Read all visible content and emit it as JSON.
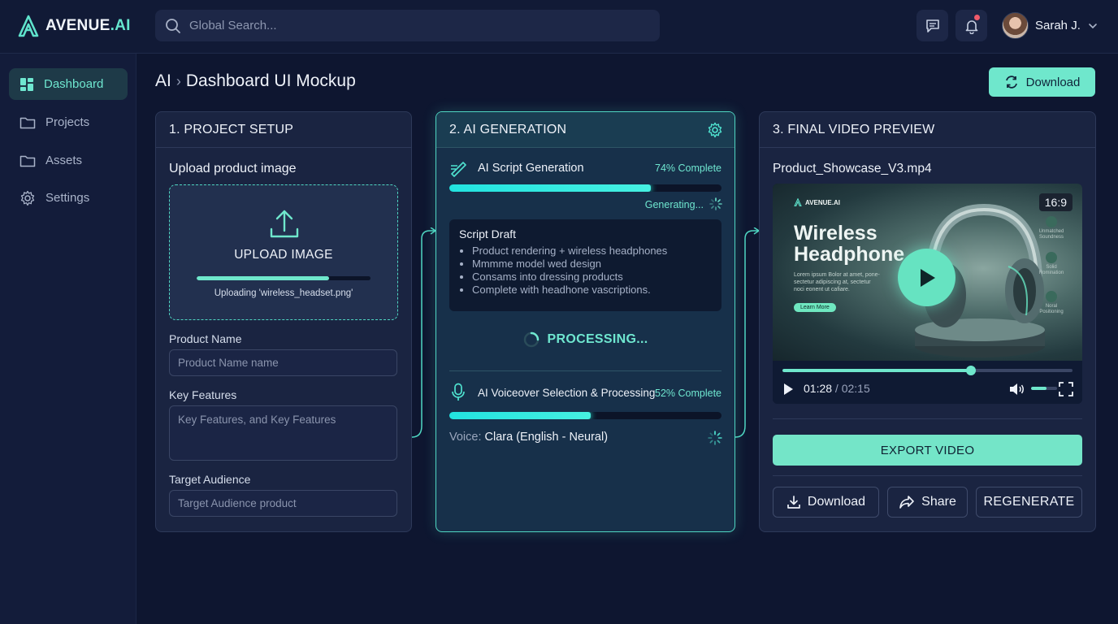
{
  "app": {
    "logo_prefix": "AVENUE",
    "logo_suffix": ".AI"
  },
  "search": {
    "placeholder": "Global Search..."
  },
  "user": {
    "name": "Sarah J."
  },
  "sidebar": {
    "items": [
      {
        "label": "Dashboard",
        "icon": "dashboard-grid-icon",
        "active": true
      },
      {
        "label": "Projects",
        "icon": "folder-icon",
        "active": false
      },
      {
        "label": "Assets",
        "icon": "folder-icon",
        "active": false
      },
      {
        "label": "Settings",
        "icon": "gear-icon",
        "active": false
      }
    ]
  },
  "breadcrumb": {
    "root": "AI",
    "current": "Dashboard UI Mockup"
  },
  "header": {
    "download_label": "Download"
  },
  "setup": {
    "title": "1. PROJECT SETUP",
    "upload_label": "Upload product image",
    "upload_button": "UPLOAD IMAGE",
    "upload_progress": 0.76,
    "upload_status": "Uploading 'wireless_headset.png'",
    "product_name_label": "Product Name",
    "product_name_placeholder": "Product Name name",
    "key_features_label": "Key Features",
    "key_features_placeholder": "Key Features, and Key Features",
    "audience_label": "Target Audience",
    "audience_placeholder": "Target Audience product"
  },
  "generation": {
    "title": "2. AI GENERATION",
    "script_label": "AI Script Generation",
    "script_pct": "74% Complete",
    "script_progress": 0.74,
    "generating_text": "Generating...",
    "draft_title": "Script Draft",
    "draft_lines": [
      "Product rendering + wireless headphones",
      "Mmmme model wed design",
      "Consams into dressing products",
      "Complete with headhone vascriptions."
    ],
    "processing_text": "PROCESSING...",
    "voice_label": "AI Voiceover Selection & Processing",
    "voice_pct": "52% Complete",
    "voice_progress": 0.52,
    "voice_prefix": "Voice:",
    "voice_value": "Clara (English - Neural)"
  },
  "preview": {
    "title": "3. FINAL VIDEO PREVIEW",
    "filename": "Product_Showcase_V3.mp4",
    "thumb_brand": "AVENUE.AI",
    "thumb_title_line1": "Wireless",
    "thumb_title_line2": "Headphone",
    "thumb_copy": "Lorem ipsum Bolor at amet, pone-\nsectetur adipiscing at, sectetur\nnoci eonent ut cafiare.",
    "thumb_cta": "Learn More",
    "aspect_ratio": "16:9",
    "features": [
      "Unmatched\nSoundness",
      "Solid\nRomination",
      "Noral\nPositioning"
    ],
    "current_time": "01:28",
    "duration": "02:15",
    "playback_progress": 0.65,
    "volume_level": 0.6,
    "export_label": "EXPORT VIDEO",
    "download_label": "Download",
    "share_label": "Share",
    "regenerate_label": "REGENERATE"
  },
  "colors": {
    "accent": "#6fe7cc",
    "background": "#0e1630",
    "panel": "#1a2441",
    "notification": "#f05a6b"
  }
}
